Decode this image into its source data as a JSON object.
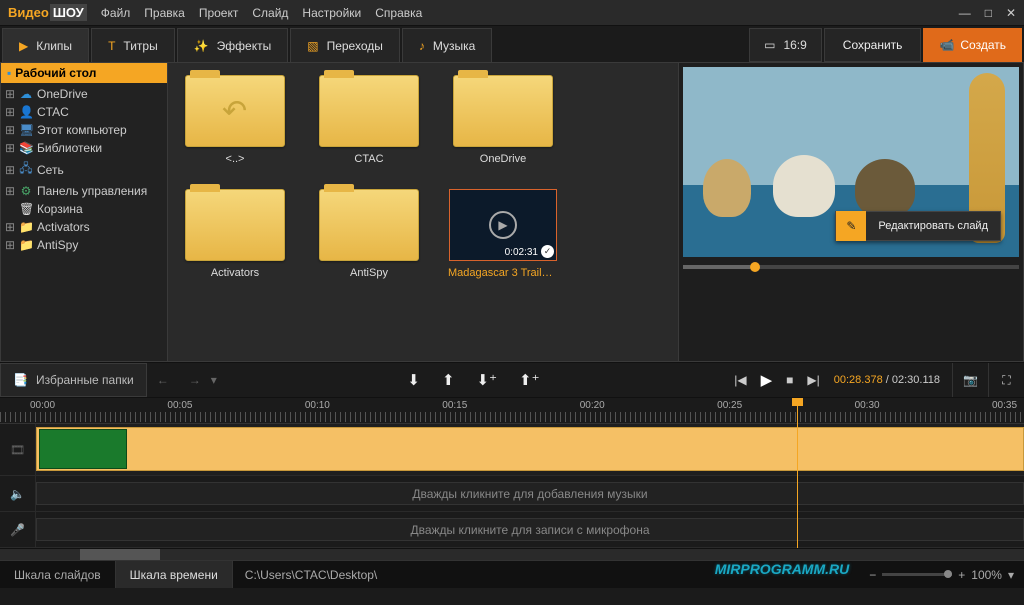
{
  "app": {
    "logo1": "Видео",
    "logo2": "ШОУ"
  },
  "menu": [
    "Файл",
    "Правка",
    "Проект",
    "Слайд",
    "Настройки",
    "Справка"
  ],
  "tabs": {
    "clips": "Клипы",
    "titles": "Титры",
    "effects": "Эффекты",
    "transitions": "Переходы",
    "music": "Музыка"
  },
  "aspect": "16:9",
  "save": "Сохранить",
  "create": "Создать",
  "side": {
    "header": "Рабочий стол",
    "items": [
      {
        "label": "OneDrive",
        "icon": "☁",
        "color": "#2e8fd8"
      },
      {
        "label": "CTAC",
        "icon": "👤",
        "color": "#c8a84a"
      },
      {
        "label": "Этот компьютер",
        "icon": "🖥",
        "color": "#4a8cc8"
      },
      {
        "label": "Библиотеки",
        "icon": "📚",
        "color": "#4a8cc8"
      },
      {
        "label": "Сеть",
        "icon": "🖧",
        "color": "#4a8cc8"
      },
      {
        "label": "Панель управления",
        "icon": "⚙",
        "color": "#4aa86a"
      },
      {
        "label": "Корзина",
        "icon": "🗑",
        "color": "#ddd",
        "noexpand": true
      },
      {
        "label": "Activators",
        "icon": "📁",
        "color": "#e7b646"
      },
      {
        "label": "AntiSpy",
        "icon": "📁",
        "color": "#e7b646"
      }
    ]
  },
  "folders": [
    "<..>",
    "CTAC",
    "OneDrive",
    "Activators",
    "AntiSpy"
  ],
  "video": {
    "label": "Madagascar 3 Trailer - ...",
    "duration": "0:02:31"
  },
  "preview": {
    "edit": "Редактировать слайд"
  },
  "fav": "Избранные папки",
  "timecode": {
    "cur": "00:28.378",
    "total": "02:30.118"
  },
  "ruler": [
    "00:00",
    "00:05",
    "00:10",
    "00:15",
    "00:20",
    "00:25",
    "00:30",
    "00:35"
  ],
  "tracks": {
    "music": "Дважды кликните для добавления музыки",
    "mic": "Дважды кликните для записи с микрофона"
  },
  "status": {
    "tab1": "Шкала слайдов",
    "tab2": "Шкала времени",
    "path": "C:\\Users\\CTAC\\Desktop\\",
    "watermark": "MIRPROGRAMM.RU",
    "zoom": "100%"
  }
}
